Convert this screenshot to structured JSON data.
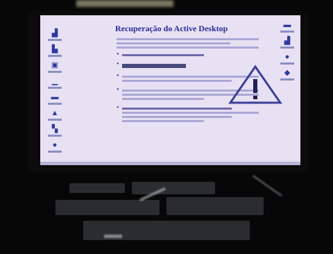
{
  "window": {
    "title": "Recuperação do Active Desktop"
  },
  "colors": {
    "screen_bg": "#e8e1f4",
    "title": "#2a2a9a",
    "icon": "#2a3aa0"
  },
  "icons": {
    "left": [
      "computer-icon",
      "network-icon",
      "documents-icon",
      "folder-icon",
      "mail-icon",
      "recycle-bin-icon",
      "printer-icon",
      "internet-icon"
    ],
    "right": [
      "globe-icon",
      "application-icon",
      "settings-icon",
      "help-icon"
    ],
    "warning": "warning-triangle-icon"
  }
}
